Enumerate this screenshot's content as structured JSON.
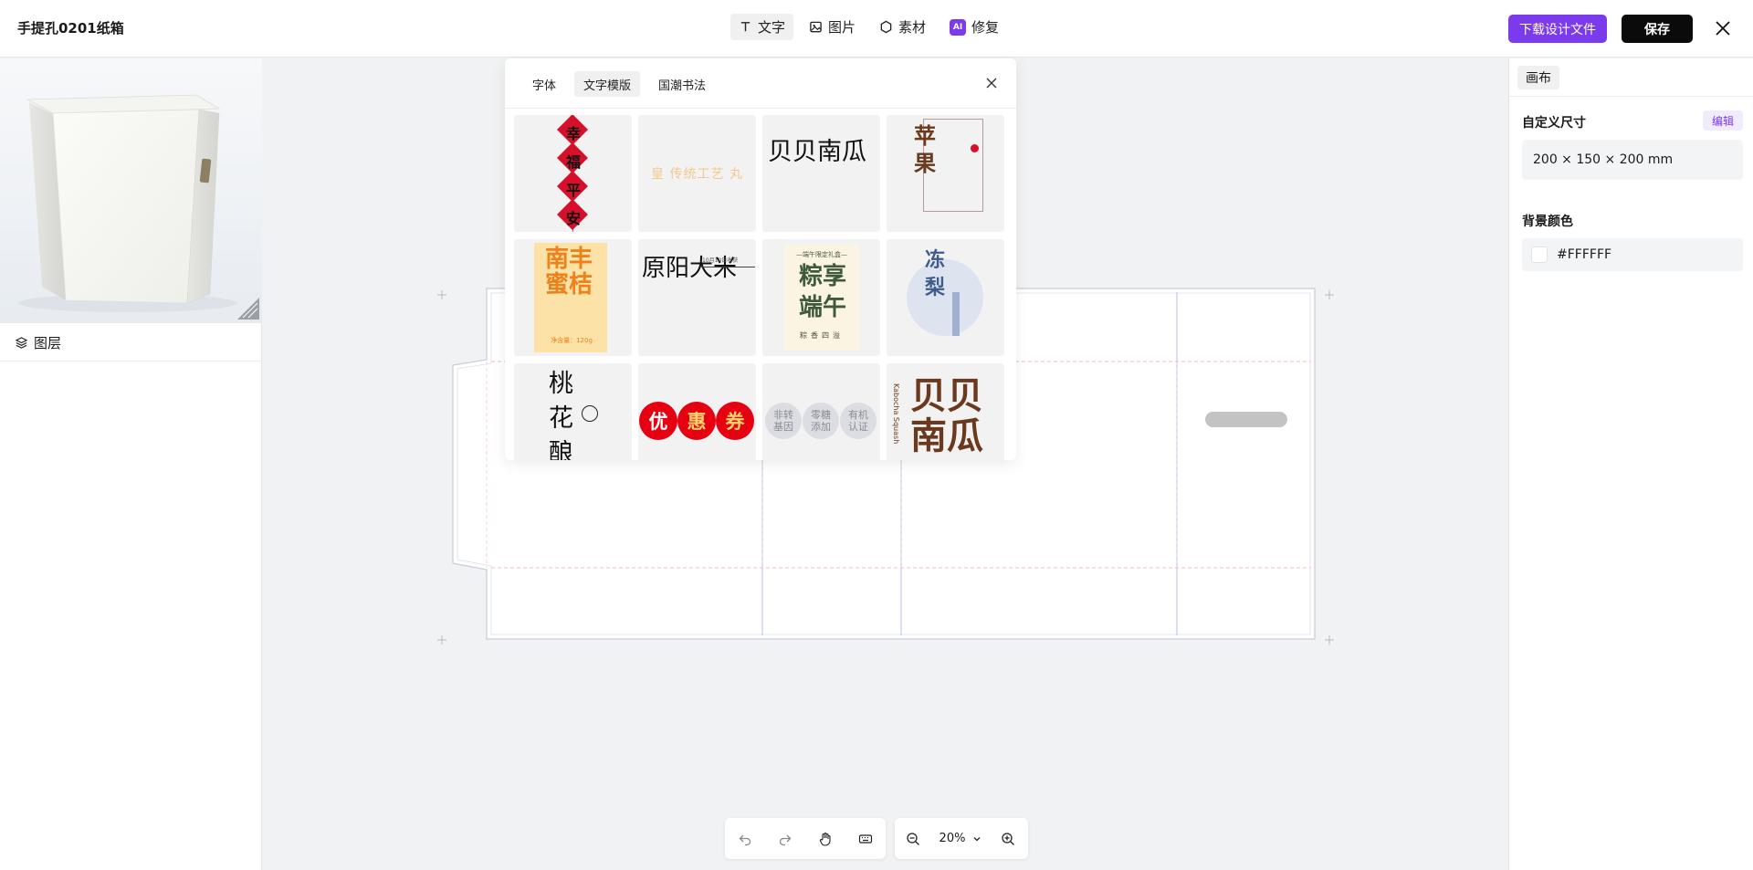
{
  "header": {
    "title": "手提孔0201纸箱",
    "tools": [
      {
        "label": "文字",
        "icon": "text-icon",
        "active": true
      },
      {
        "label": "图片",
        "icon": "image-icon",
        "active": false
      },
      {
        "label": "素材",
        "icon": "hexagon-icon",
        "active": false
      },
      {
        "label": "修复",
        "icon": "ai-icon",
        "badge": "AI",
        "active": false
      }
    ],
    "download_label": "下载设计文件",
    "save_label": "保存"
  },
  "left_panel": {
    "layers_label": "图层"
  },
  "text_panel": {
    "tabs": [
      "字体",
      "文字模版",
      "国潮书法"
    ],
    "active_tab": "文字模版",
    "templates": [
      {
        "text": "幸福平安"
      },
      {
        "text": "皇 传统工艺 丸"
      },
      {
        "text": "贝贝南瓜"
      },
      {
        "text": "苹果"
      },
      {
        "text": "南丰蜜桔",
        "subtext": "净含量：120g"
      },
      {
        "text": "原阳大米",
        "subtext": "10月10日收获"
      },
      {
        "text": "粽享端午",
        "header": "—端午限定礼盒—",
        "footer": "粽香四溢"
      },
      {
        "text": "冻梨"
      },
      {
        "text": "桃花酿"
      },
      {
        "badges": [
          "优",
          "惠",
          "券"
        ]
      },
      {
        "badges": [
          "非转基因",
          "零糖添加",
          "有机认证"
        ]
      },
      {
        "text": "贝贝南瓜",
        "side": "Kabocha Squash"
      }
    ]
  },
  "right_panel": {
    "tab_label": "画布",
    "size_label": "自定义尺寸",
    "edit_label": "编辑",
    "size_value": "200 × 150 × 200 mm",
    "bg_label": "背景颜色",
    "bg_value": "#FFFFFF"
  },
  "bottom_toolbar": {
    "zoom": "20%"
  },
  "colors": {
    "accent": "#7c3aed",
    "dark": "#0b0b0b",
    "festival_red": "#d6102a"
  }
}
